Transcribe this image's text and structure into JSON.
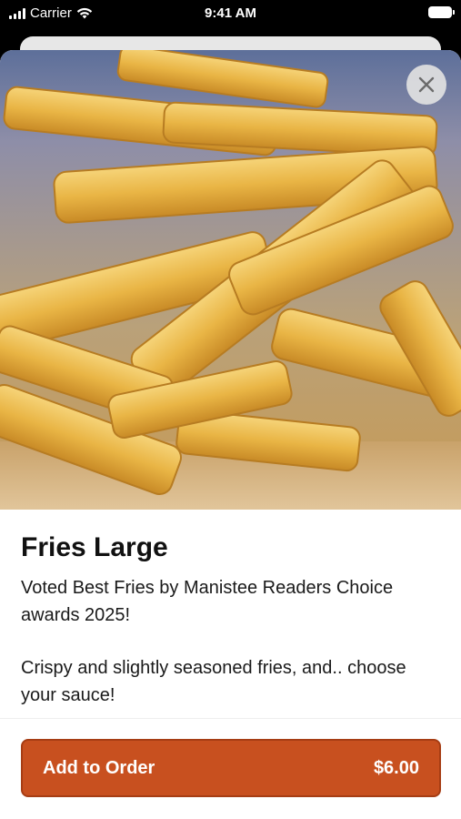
{
  "status_bar": {
    "carrier": "Carrier",
    "time": "9:41 AM"
  },
  "item": {
    "name": "Fries Large",
    "description_1": "Voted Best Fries by Manistee Readers Choice awards 2025!",
    "description_2": "Crispy and slightly seasoned fries, and.. choose your sauce!"
  },
  "order_button": {
    "label": "Add to Order",
    "price": "$6.00"
  },
  "colors": {
    "accent": "#c8501f"
  },
  "icons": {
    "close": "close-icon",
    "wifi": "wifi-icon",
    "signal": "signal-icon",
    "battery": "battery-icon"
  }
}
